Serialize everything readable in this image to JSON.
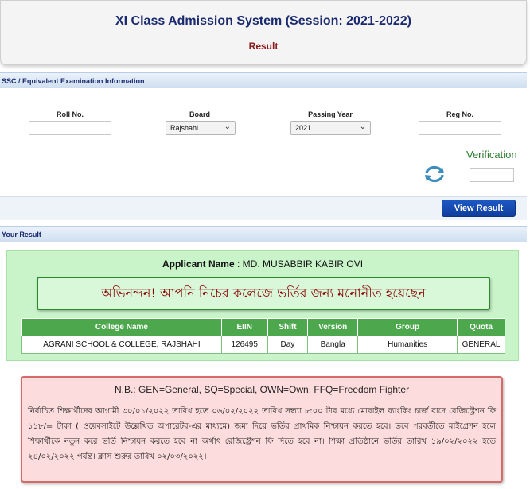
{
  "header": {
    "title": "XI Class Admission System (Session: 2021-2022)",
    "subtitle": "Result"
  },
  "ssc_section": {
    "title": "SSC / Equivalent Examination Information",
    "roll_label": "Roll No.",
    "roll_value": "",
    "board_label": "Board",
    "board_value": "Rajshahi",
    "year_label": "Passing Year",
    "year_value": "2021",
    "reg_label": "Reg No.",
    "reg_value": "",
    "verification_label": "Verification",
    "verification_value": "",
    "view_button": "View Result"
  },
  "result_section": {
    "title": "Your Result",
    "applicant_label": "Applicant Name",
    "applicant_name": ": MD. MUSABBIR KABIR OVI",
    "congrats": "অভিনন্দন! আপনি নিচের কলেজে ভর্তির জন্য মনোনীত হয়েছেন",
    "columns": [
      "College Name",
      "EIIN",
      "Shift",
      "Version",
      "Group",
      "Quota"
    ],
    "rows": [
      [
        "AGRANI SCHOOL & COLLEGE, RAJSHAHI",
        "126495",
        "Day",
        "Bangla",
        "Humanities",
        "GENERAL"
      ]
    ]
  },
  "note": {
    "heading": "N.B.: GEN=General, SQ=Special, OWN=Own, FFQ=Freedom Fighter",
    "body": "নির্বাচিত শিক্ষার্থীদের আগামী ৩০/০১/২০২২ তারিখ হতে ০৬/০২/২০২২ তারিখ সন্ধ্যা ৮:০০ টার মধ্যে মোবাইল ব্যাংকিং চার্জ বাদে রেজিস্ট্রেশন ফি ১১৮/= টাকা ( ওয়েবসাইটে উল্লেখিত অপারেটর-এর মাধ্যমে) জমা দিয়ে ভর্তির প্রাথমিক নিশ্চায়ন করতে হবে। তবে পরবর্তীতে মাইগ্রেশন হলে শিক্ষার্থীকে নতুন করে ভর্তি নিশ্চায়ন করতে হবে না অর্থাৎ রেজিস্ট্রেশন ফি দিতে হবে না। শিক্ষা প্রতিষ্ঠানে ভর্তির তারিখ ১৯/০২/২০২২ হতে ২৪/০২/২০২২ পর্যন্ত। ক্লাস শুরুর তারিখ ০২/০৩/২০২২।"
  },
  "icons": {
    "refresh": "refresh-icon",
    "dropdown": "chevron-down-icon"
  },
  "colors": {
    "title_blue": "#1a2a6e",
    "button_blue": "#1d58c4",
    "result_green": "#c9f3c9",
    "table_header_green": "#4da84d",
    "note_red": "#fcdcdc"
  }
}
